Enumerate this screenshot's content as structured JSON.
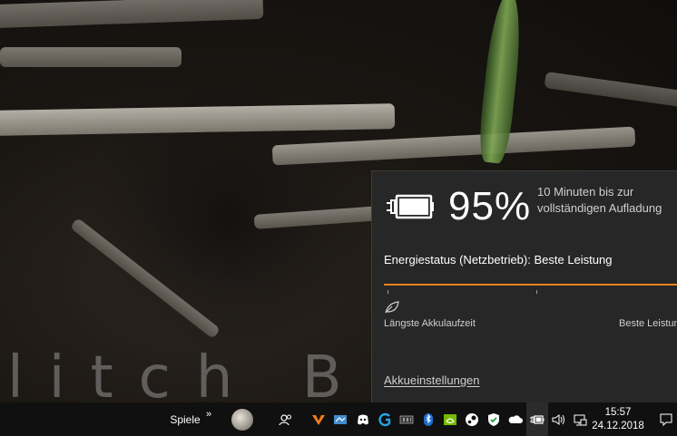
{
  "wallpaper": {
    "text": "litch B"
  },
  "flyout": {
    "percent": "95%",
    "time_remaining": "10 Minuten bis zur vollständigen Aufladung",
    "energy_status": "Energiestatus (Netzbetrieb): Beste Leistung",
    "power_mode_level": 1.0,
    "label_left": "Längste Akkulaufzeit",
    "label_right": "Beste Leistung",
    "settings_link": "Akkueinstellungen",
    "accent_color": "#e8841d"
  },
  "taskbar": {
    "toolbar_label": "Spiele",
    "chevron": "»",
    "icons": [
      "user-avatar",
      "people-icon",
      "orange-v-app-icon",
      "network-app-icon",
      "discord-icon",
      "gaming-g-icon",
      "ssd-icon",
      "bluetooth-icon",
      "nvidia-icon",
      "steam-icon",
      "security-shield-icon",
      "onedrive-cloud-icon",
      "battery-charging-icon",
      "volume-icon",
      "network-icon"
    ],
    "time": "15:57",
    "date": "24.12.2018"
  }
}
